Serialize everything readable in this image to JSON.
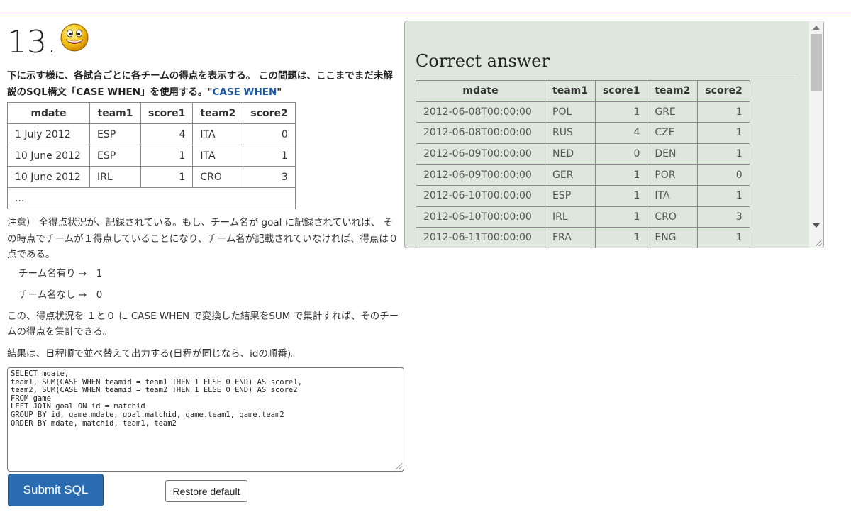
{
  "question": {
    "number": "13.",
    "intro_prefix": "下に示す様に、各試合ごとに各チームの得点を表示する。 この問題は、ここまでまだ未解説のSQL構文「CASE WHEN」を使用する。\"",
    "intro_link": "CASE WHEN",
    "intro_suffix": "\""
  },
  "sample_table": {
    "headers": [
      "mdate",
      "team1",
      "score1",
      "team2",
      "score2"
    ],
    "rows": [
      [
        "1 July 2012",
        "ESP",
        "4",
        "ITA",
        "0"
      ],
      [
        "10 June 2012",
        "ESP",
        "1",
        "ITA",
        "1"
      ],
      [
        "10 June 2012",
        "IRL",
        "1",
        "CRO",
        "3"
      ]
    ],
    "ellipsis": "..."
  },
  "notes": {
    "note1": "注意） 全得点状況が、記録されている。もし、チーム名が goal に記録されていれば、 その時点でチームが１得点していることになり、チーム名が記載されていなければ、得点は０点である。",
    "with_team": "チーム名有り →　1",
    "without_team": "チーム名なし →　0",
    "para": "この、得点状況を １と０ に CASE WHEN で変換した結果をSUM で集計すれば、そのチームの得点を集計できる。",
    "result": "結果は、日程順で並べ替えて出力する(日程が同じなら、idの順番)。"
  },
  "sql": "SELECT mdate,\nteam1, SUM(CASE WHEN teamid = team1 THEN 1 ELSE 0 END) AS score1,\nteam2, SUM(CASE WHEN teamid = team2 THEN 1 ELSE 0 END) AS score2\nFROM game\nLEFT JOIN goal ON id = matchid\nGROUP BY id, game.mdate, goal.matchid, game.team1, game.team2\nORDER BY mdate, matchid, team1, team2",
  "buttons": {
    "submit": "Submit SQL",
    "restore": "Restore default"
  },
  "answer": {
    "title": "Correct answer",
    "headers": [
      "mdate",
      "team1",
      "score1",
      "team2",
      "score2"
    ],
    "rows": [
      [
        "2012-06-08T00:00:00",
        "POL",
        "1",
        "GRE",
        "1"
      ],
      [
        "2012-06-08T00:00:00",
        "RUS",
        "4",
        "CZE",
        "1"
      ],
      [
        "2012-06-09T00:00:00",
        "NED",
        "0",
        "DEN",
        "1"
      ],
      [
        "2012-06-09T00:00:00",
        "GER",
        "1",
        "POR",
        "0"
      ],
      [
        "2012-06-10T00:00:00",
        "ESP",
        "1",
        "ITA",
        "1"
      ],
      [
        "2012-06-10T00:00:00",
        "IRL",
        "1",
        "CRO",
        "3"
      ],
      [
        "2012-06-11T00:00:00",
        "FRA",
        "1",
        "ENG",
        "1"
      ]
    ]
  },
  "colors": {
    "link": "#1a56a6",
    "submit_bg": "#2b6cb0",
    "panel_bg": "#dde7dc",
    "top_rule": "#f0b27a"
  }
}
